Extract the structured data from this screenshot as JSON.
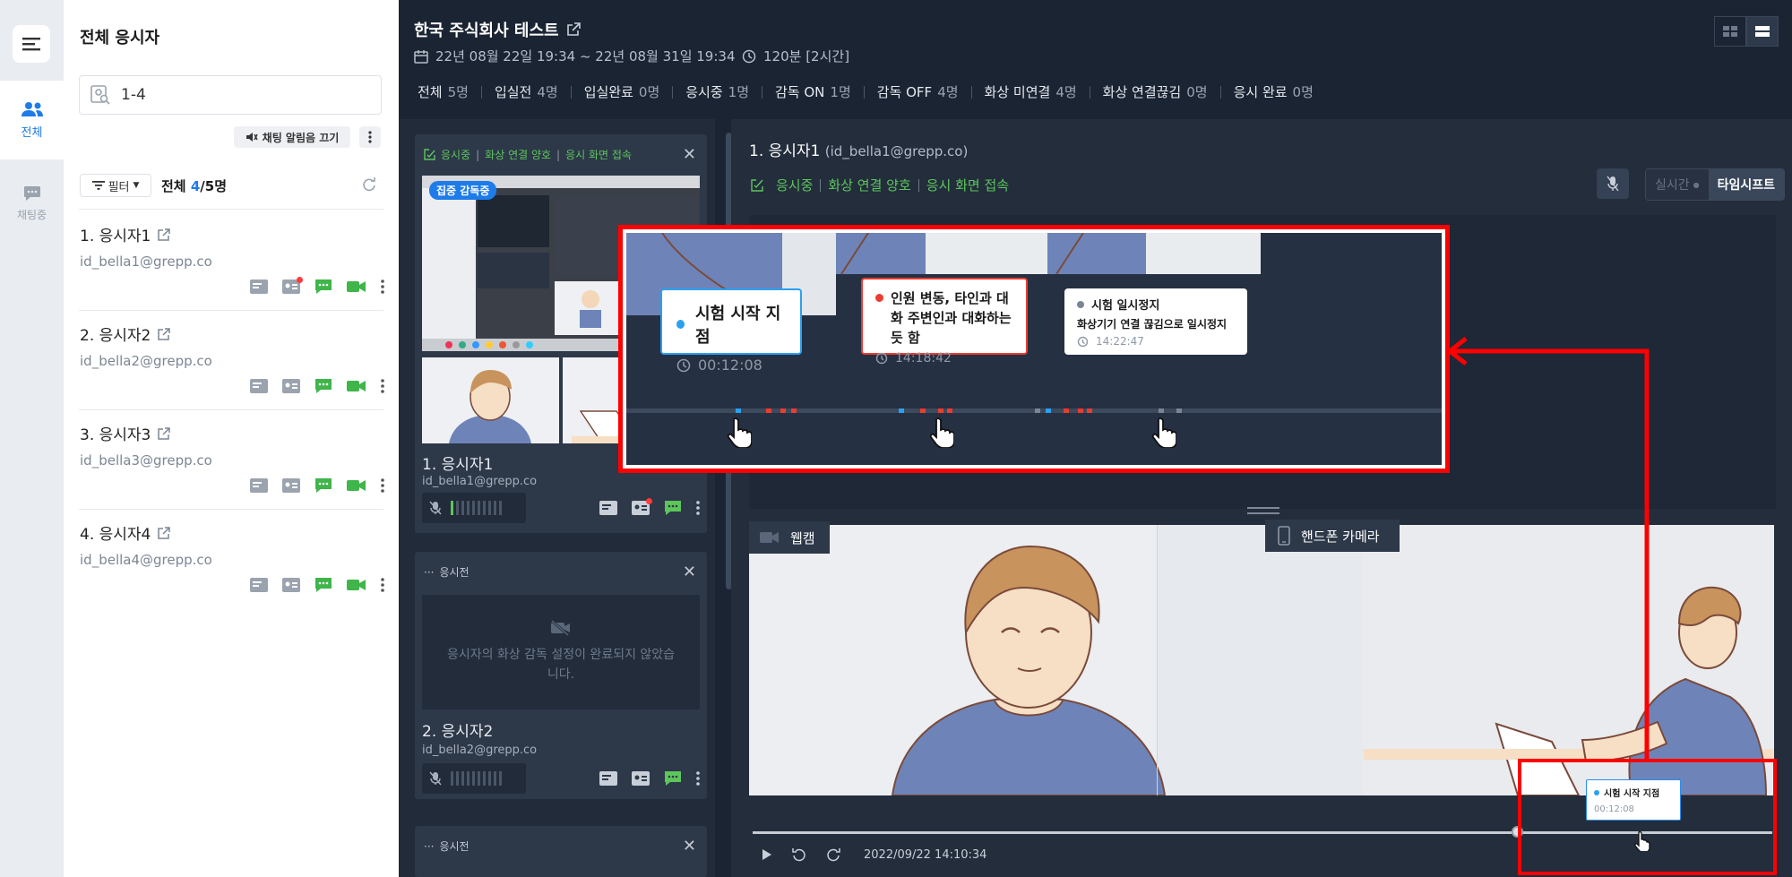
{
  "rail": {
    "all_label": "전체",
    "chat_label": "채팅중"
  },
  "list": {
    "title": "전체 응시자",
    "search_value": "1-4",
    "mute_btn": "채팅 알림음 끄기",
    "filter_btn": "필터",
    "count_prefix": "전체",
    "count_current": "4",
    "count_total": "/5명",
    "candidates": [
      {
        "name": "1. 응시자1",
        "email": "id_bella1@grepp.co"
      },
      {
        "name": "2. 응시자2",
        "email": "id_bella2@grepp.co"
      },
      {
        "name": "3. 응시자3",
        "email": "id_bella3@grepp.co"
      },
      {
        "name": "4. 응시자4",
        "email": "id_bella4@grepp.co"
      }
    ]
  },
  "header": {
    "title": "한국 주식회사 테스트",
    "date": "22년 08월 22일 19:34 ~ 22년 08월 31일 19:34",
    "duration": "120분 [2시간]",
    "stats": [
      {
        "label": "전체",
        "value": "5명"
      },
      {
        "label": "입실전",
        "value": "4명"
      },
      {
        "label": "입실완료",
        "value": "0명"
      },
      {
        "label": "응시중",
        "value": "1명"
      },
      {
        "label": "감독 ON",
        "value": "1명"
      },
      {
        "label": "감독 OFF",
        "value": "4명"
      },
      {
        "label": "화상 미연결",
        "value": "4명"
      },
      {
        "label": "화상 연결끊김",
        "value": "0명"
      },
      {
        "label": "응시 완료",
        "value": "0명"
      }
    ]
  },
  "cards": [
    {
      "s1": "응시중",
      "s2": "화상 연결 양호",
      "s3": "응시 화면 접속",
      "badge": "집중 감독중",
      "name": "1. 응시자1",
      "email": "id_bella1@grepp.co"
    },
    {
      "status": "응시전",
      "nocam": "응시자의 화상 감독 설정이 완료되지 않았습니다.",
      "name": "2. 응시자2",
      "email": "id_bella2@grepp.co"
    },
    {
      "status": "응시전"
    }
  ],
  "main": {
    "name": "1. 응시자1",
    "email": "(id_bella1@grepp.co)",
    "s1": "응시중",
    "s2": "화상 연결 양호",
    "s3": "응시 화면 접속",
    "toggle_live": "실시간",
    "toggle_timeshift": "타임시프트",
    "webcam": "웹캠",
    "phone": "핸드폰 카메라",
    "timestamp": "2022/09/22 14:10:34",
    "progress": 0.75
  },
  "zoom": {
    "tips": [
      {
        "title": "시험 시작 지점",
        "time": "00:12:08",
        "color": "#2aa0f0"
      },
      {
        "title": "인원 변동, 타인과 대화 주변인과 대화하는듯 함",
        "time": "14:18:42",
        "color": "#ee3b2f"
      },
      {
        "title": "시험 일시정지",
        "detail": "화상기기 연결 끊김으로 일시정지",
        "time": "14:22:47",
        "color": "#7a8594"
      }
    ]
  },
  "minitip": {
    "title": "시험 시작 지점",
    "time": "00:12:08"
  },
  "colors": {
    "accent": "#1e7bea",
    "ok": "#5dc65b",
    "alert": "#ff0000"
  }
}
